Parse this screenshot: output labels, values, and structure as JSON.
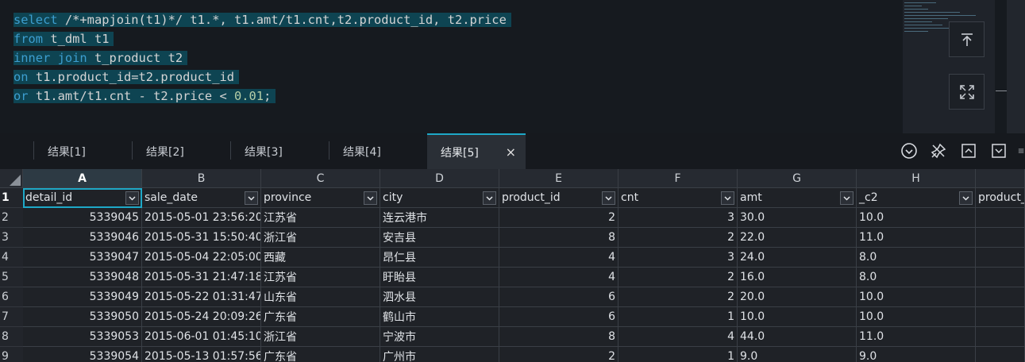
{
  "editor": {
    "lines": [
      {
        "kw": "select",
        "rest": " /*+mapjoin(t1)*/ t1.*, t1.amt/t1.cnt,t2.product_id, t2.price"
      },
      {
        "kw": "from",
        "rest": " t_dml t1"
      },
      {
        "kw": "inner join",
        "rest": " t_product t2"
      },
      {
        "kw": "on",
        "rest": " t1.product_id=t2.product_id"
      },
      {
        "kw": "or",
        "rest": " t1.amt/t1.cnt - t2.price < ",
        "num": "0.01",
        "tail": ";"
      }
    ]
  },
  "side_buttons": {
    "top_icon": "arrow-to-top-icon",
    "fullscreen_icon": "expand-icon"
  },
  "tabs": [
    {
      "label": "结果[1]",
      "active": false
    },
    {
      "label": "结果[2]",
      "active": false
    },
    {
      "label": "结果[3]",
      "active": false
    },
    {
      "label": "结果[4]",
      "active": false
    },
    {
      "label": "结果[5]",
      "active": true,
      "close": "×"
    }
  ],
  "toolbar_icons": [
    "check-circle-icon",
    "pin-off-icon",
    "collapse-up-icon",
    "collapse-down-icon",
    "more-icon"
  ],
  "grid": {
    "col_letters": [
      "A",
      "B",
      "C",
      "D",
      "E",
      "F",
      "G",
      "H",
      ""
    ],
    "row_numbers": [
      "1",
      "2",
      "3",
      "4",
      "5",
      "6",
      "7",
      "8",
      "9"
    ],
    "headers": [
      "detail_id",
      "sale_date",
      "province",
      "city",
      "product_id",
      "cnt",
      "amt",
      "_c2",
      "product_i"
    ],
    "rows": [
      [
        "5339045",
        "2015-05-01 23:56:20",
        "江苏省",
        "连云港市",
        "2",
        "3",
        "30.0",
        "10.0"
      ],
      [
        "5339046",
        "2015-05-31 15:50:40",
        "浙江省",
        "安吉县",
        "8",
        "2",
        "22.0",
        "11.0"
      ],
      [
        "5339047",
        "2015-05-04 22:05:00",
        "西藏",
        "昂仁县",
        "4",
        "3",
        "24.0",
        "8.0"
      ],
      [
        "5339048",
        "2015-05-31 21:47:18",
        "江苏省",
        "盱眙县",
        "4",
        "2",
        "16.0",
        "8.0"
      ],
      [
        "5339049",
        "2015-05-22 01:31:47",
        "山东省",
        "泗水县",
        "6",
        "2",
        "20.0",
        "10.0"
      ],
      [
        "5339050",
        "2015-05-24 20:09:26",
        "广东省",
        "鹤山市",
        "6",
        "1",
        "10.0",
        "10.0"
      ],
      [
        "5339053",
        "2015-06-01 01:45:10",
        "浙江省",
        "宁波市",
        "8",
        "4",
        "44.0",
        "11.0"
      ],
      [
        "5339054",
        "2015-05-13 01:57:56",
        "广东省",
        "广州市",
        "2",
        "1",
        "9.0",
        "9.0"
      ]
    ]
  },
  "colors": {
    "accent": "#1ea8c7",
    "keyword": "#3d9ed0",
    "selection": "#0e4452"
  }
}
